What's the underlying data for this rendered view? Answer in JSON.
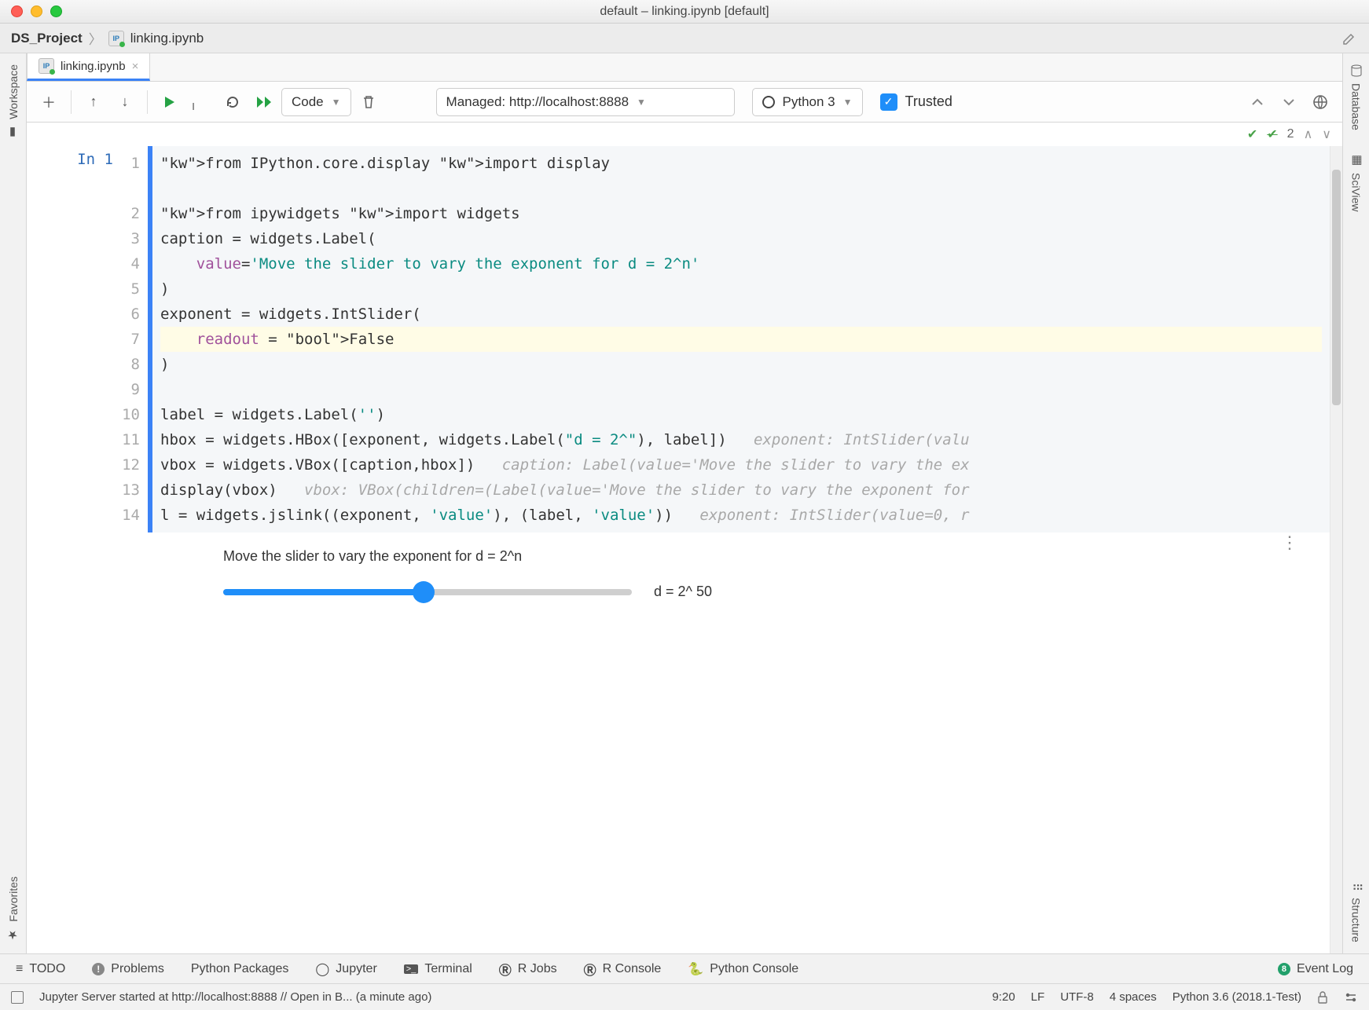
{
  "window": {
    "title": "default – linking.ipynb [default]"
  },
  "breadcrumb": {
    "project": "DS_Project",
    "file": "linking.ipynb"
  },
  "tabs": [
    {
      "label": "linking.ipynb"
    }
  ],
  "toolbar": {
    "cell_type": "Code",
    "server": "Managed: http://localhost:8888",
    "kernel": "Python 3",
    "trusted": "Trusted"
  },
  "inspection_strip": {
    "count": "2"
  },
  "side": {
    "left_top": "Workspace",
    "left_bottom": "Favorites",
    "right_top": "Database",
    "right_mid": "SciView",
    "right_bottom": "Structure"
  },
  "cell": {
    "prompt": "In 1",
    "lines": [
      "from IPython.core.display import display",
      "",
      "from ipywidgets import widgets",
      "caption = widgets.Label(",
      "    value='Move the slider to vary the exponent for d = 2^n'",
      ")",
      "exponent = widgets.IntSlider(",
      "    readout = False",
      ")",
      "",
      "label = widgets.Label('')",
      "hbox = widgets.HBox([exponent, widgets.Label(\"d = 2^\"), label])",
      "vbox = widgets.VBox([caption,hbox])",
      "display(vbox)",
      "l = widgets.jslink((exponent, 'value'), (label, 'value'))"
    ],
    "inlays": {
      "11": "exponent: IntSlider(valu",
      "12": "caption: Label(value='Move the slider to vary the ex",
      "13": "vbox: VBox(children=(Label(value='Move the slider to vary the exponent for",
      "14": "exponent: IntSlider(value=0, r"
    }
  },
  "output": {
    "caption": "Move the slider to vary the exponent for d = 2^n",
    "label_text": "d = 2^ 50"
  },
  "bottom_tabs": {
    "todo": "TODO",
    "problems": "Problems",
    "packages": "Python Packages",
    "jupyter": "Jupyter",
    "terminal": "Terminal",
    "rjobs": "R Jobs",
    "rconsole": "R Console",
    "pyconsole": "Python Console",
    "eventlog": "Event Log"
  },
  "status": {
    "message": "Jupyter Server started at http://localhost:8888 // Open in B... (a minute ago)",
    "pos": "9:20",
    "eol": "LF",
    "enc": "UTF-8",
    "indent": "4 spaces",
    "interp": "Python 3.6 (2018.1-Test)"
  }
}
